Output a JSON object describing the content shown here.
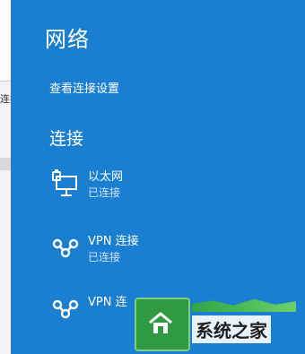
{
  "background_app": {
    "fragment": "连接"
  },
  "panel": {
    "title": "网络",
    "settings_link": "查看连接设置",
    "section_heading": "连接",
    "connections": [
      {
        "icon": "ethernet-icon",
        "name": "以太网",
        "status": "已连接"
      },
      {
        "icon": "vpn-icon",
        "name": "VPN 连接",
        "status": "已连接"
      },
      {
        "icon": "vpn-icon",
        "name": "VPN 连",
        "status": ""
      }
    ]
  },
  "watermark": {
    "text": "系统之家"
  },
  "colors": {
    "panel_bg": "#1a7fd0",
    "text": "#ffffff",
    "status_text": "#cfe4f7",
    "watermark_green": "#2f9a42"
  }
}
